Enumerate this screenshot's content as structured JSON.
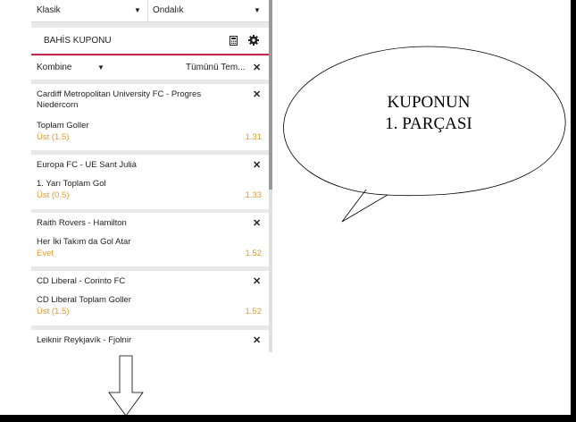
{
  "selectors": {
    "left": {
      "label": "Klasik"
    },
    "right": {
      "label": "Ondalık"
    }
  },
  "header": {
    "title": "BAHİS KUPONU",
    "icons": [
      "calculator-icon",
      "gear-icon"
    ]
  },
  "bet_type": {
    "label": "Kombine",
    "clear_label": "Tümünü Tem...",
    "close_symbol": "✕"
  },
  "bets": [
    {
      "match_line1": "Cardiff Metropolitan University FC - Progres",
      "match_line2": "Niedercorn",
      "market": "Toplam Goller",
      "pick": "Üst (1.5)",
      "odds": "1.31"
    },
    {
      "match_line1": "Europa FC - UE Sant Julià",
      "match_line2": "",
      "market": "1. Yarı Toplam Gol",
      "pick": "Üst (0.5)",
      "odds": "1.33"
    },
    {
      "match_line1": "Raith Rovers - Hamilton",
      "match_line2": "",
      "market": "Her İki Takım da Gol Atar",
      "pick": "Evet",
      "odds": "1.52"
    },
    {
      "match_line1": "CD Liberal - Corinto FC",
      "match_line2": "",
      "market": "CD Liberal Toplam Goller",
      "pick": "Üst (1.5)",
      "odds": "1.52"
    },
    {
      "match_line1": "Leiknir Reykjavík - Fjolnir",
      "match_line2": "",
      "market": "",
      "pick": "",
      "odds": ""
    }
  ],
  "callout": {
    "line1": "KUPONUN",
    "line2": "1. PARÇASI"
  },
  "colors": {
    "accent": "#c8264f",
    "odds": "#e09a2c",
    "panel_bg": "#e9e9e9",
    "frame": "#000000"
  }
}
